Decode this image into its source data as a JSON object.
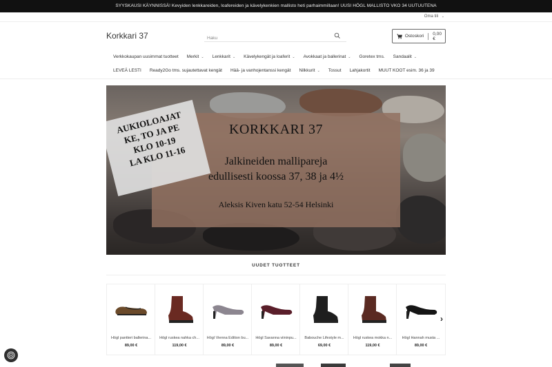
{
  "announcement": "SYYSKAUSI KÄYNNISSÄ! Kevyiden lenkkareiden, loafereiden ja kävelykenkien mallisto heti parhaimmillaan! UUSI HÖGL MALLISTO VKO 34 UUTUUTENA",
  "account": {
    "label": "Oma tili"
  },
  "logo": "Korkkari 37",
  "search": {
    "placeholder": "Haku",
    "icon": "search-icon"
  },
  "cart": {
    "label": "Ostoskori",
    "total": "0,00 €",
    "icon": "cart-icon"
  },
  "nav": {
    "row1": [
      {
        "label": "Verkkokaupan uusimmat tuotteet",
        "dropdown": false
      },
      {
        "label": "Merkit",
        "dropdown": true
      },
      {
        "label": "Lenkkarit",
        "dropdown": true
      },
      {
        "label": "Kävelykengät ja loaferit",
        "dropdown": true
      },
      {
        "label": "Avokkaat ja ballerinat",
        "dropdown": true
      },
      {
        "label": "Goretex tms.",
        "dropdown": false
      },
      {
        "label": "Sandaalit",
        "dropdown": true
      }
    ],
    "row2": [
      {
        "label": "LEVEÄ LESTI",
        "dropdown": false
      },
      {
        "label": "Ready2Go tms. sujautettavat kengät",
        "dropdown": false
      },
      {
        "label": "Hää- ja vanhojentanssi kengät",
        "dropdown": false
      },
      {
        "label": "Nilkkurit",
        "dropdown": true
      },
      {
        "label": "Tossut",
        "dropdown": false
      },
      {
        "label": "Lahjakortit",
        "dropdown": false
      },
      {
        "label": "MUUT KOOT esim. 36 ja 39",
        "dropdown": false
      }
    ]
  },
  "hero": {
    "hours": [
      "AUKIOLOAJAT",
      "KE, TO JA PE",
      "KLO 10-19",
      "LA KLO 11-16"
    ],
    "title": "KORKKARI 37",
    "line1": "Jalkineiden mallipareja",
    "line2": "edullisesti koossa 37, 38 ja 4½",
    "address": "Aleksis Kiven katu 52-54 Helsinki"
  },
  "section_title": "UUDET TUOTTEET",
  "products": [
    {
      "name": "Högl pantteri ballerina...",
      "price": "89,00 €",
      "shoe": "flat",
      "color": "#6b4a2a"
    },
    {
      "name": "Högl ruskea nahka ch...",
      "price": "119,00 €",
      "shoe": "boot",
      "color": "#6a2a22"
    },
    {
      "name": "Högl Vienna Edition bu...",
      "price": "89,00 €",
      "shoe": "pump",
      "color": "#8c8690"
    },
    {
      "name": "Högl Savanna viininpu...",
      "price": "89,00 €",
      "shoe": "pump",
      "color": "#5a1e2a"
    },
    {
      "name": "Babouche Lifestyle m...",
      "price": "69,00 €",
      "shoe": "boot",
      "color": "#1e1e1e"
    },
    {
      "name": "Högl ruskea mokka n...",
      "price": "119,00 €",
      "shoe": "boot",
      "color": "#5a2a22"
    },
    {
      "name": "Högl Hannah musta ...",
      "price": "89,00 €",
      "shoe": "pump",
      "color": "#151515"
    }
  ],
  "carousel": {
    "next_icon": "chevron-right-icon"
  },
  "chat": {
    "icon": "chat-icon"
  }
}
